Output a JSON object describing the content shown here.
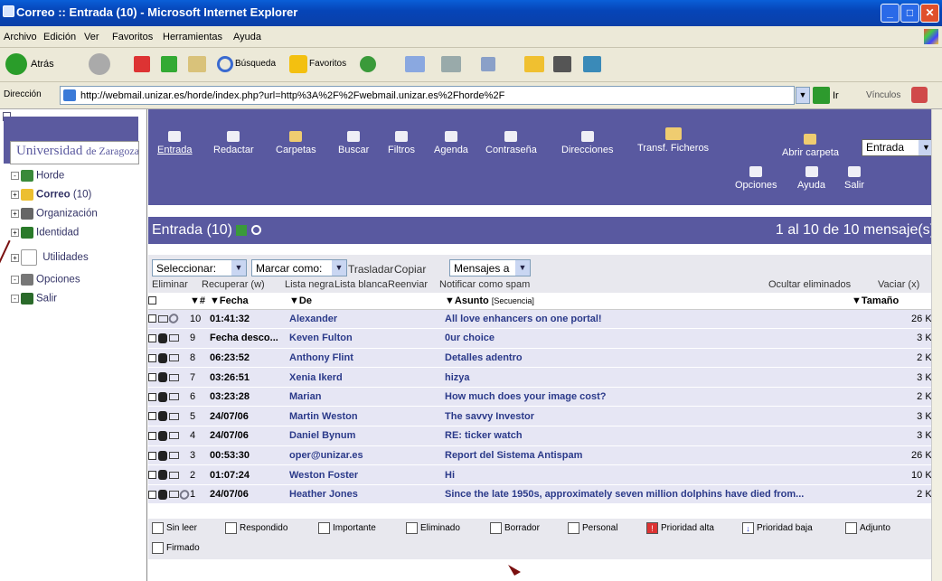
{
  "window": {
    "title": "Correo :: Entrada (10) - Microsoft Internet Explorer",
    "min": "_",
    "max": "□",
    "close": "✕"
  },
  "menu": [
    "Archivo",
    "Edición",
    "Ver",
    "Favoritos",
    "Herramientas",
    "Ayuda"
  ],
  "toolbar": {
    "back": "Atrás",
    "search": "Búsqueda",
    "favorites": "Favoritos"
  },
  "address": {
    "label": "Dirección",
    "url": "http://webmail.unizar.es/horde/index.php?url=http%3A%2F%2Fwebmail.unizar.es%2Fhorde%2F",
    "go": "Ir",
    "links": "Vínculos"
  },
  "sidebar": {
    "logo_line1": "Universidad",
    "logo_line2": "de Zaragoza",
    "items": [
      {
        "label": "Horde"
      },
      {
        "label": "Correo",
        "count": "(10)"
      },
      {
        "label": "Organización"
      },
      {
        "label": "Identidad"
      },
      {
        "label": "Utilidades"
      },
      {
        "label": "Opciones"
      },
      {
        "label": "Salir"
      }
    ]
  },
  "nav": {
    "items": [
      "Entrada",
      "Redactar",
      "Carpetas",
      "Buscar",
      "Filtros",
      "Agenda",
      "Contraseña",
      "Direcciones",
      "Transf. Ficheros"
    ],
    "open_folder": "Abrir carpeta",
    "folder_select": "Entrada",
    "options": "Opciones",
    "help": "Ayuda",
    "exit": "Salir"
  },
  "header": {
    "folder": "Entrada (10)",
    "range": "1 al 10 de 10 mensaje(s)"
  },
  "actions": {
    "select": "Seleccionar:",
    "mark_as": "Marcar como:",
    "move": "Trasladar",
    "copy": "Copiar",
    "messages_to": "Mensajes a",
    "links": [
      "Eliminar",
      "Recuperar (w)",
      "Lista negra",
      "Lista blanca",
      "Reenviar",
      "Notificar como spam"
    ],
    "hide_deleted": "Ocultar eliminados",
    "empty": "Vaciar (x)"
  },
  "columns": {
    "num": "▼#",
    "date": "▼Fecha",
    "from": "▼De",
    "subject": "▼Asunto",
    "sequence": "[Secuencia]",
    "size": "▼Tamaño"
  },
  "messages": [
    {
      "num": "10",
      "date": "01:41:32",
      "from": "Alexander",
      "subject": "All love enhancers on one portal!",
      "size": "26 KB"
    },
    {
      "num": "9",
      "date": "Fecha desco...",
      "from": "Keven Fulton",
      "subject": "0ur choice",
      "size": "3 KB"
    },
    {
      "num": "8",
      "date": "06:23:52",
      "from": "Anthony Flint",
      "subject": "Detalles adentro",
      "size": "2 KB"
    },
    {
      "num": "7",
      "date": "03:26:51",
      "from": "Xenia Ikerd",
      "subject": "hizya",
      "size": "3 KB"
    },
    {
      "num": "6",
      "date": "03:23:28",
      "from": "Marian",
      "subject": "How much does your image cost?",
      "size": "2 KB"
    },
    {
      "num": "5",
      "date": "24/07/06",
      "from": "Martin Weston",
      "subject": "The savvy Investor",
      "size": "3 KB"
    },
    {
      "num": "4",
      "date": "24/07/06",
      "from": "Daniel Bynum",
      "subject": "RE: ticker watch",
      "size": "3 KB"
    },
    {
      "num": "3",
      "date": "00:53:30",
      "from": "oper@unizar.es",
      "subject": "Report del Sistema Antispam",
      "size": "26 KB"
    },
    {
      "num": "2",
      "date": "01:07:24",
      "from": "Weston Foster",
      "subject": "Hi",
      "size": "10 KB"
    },
    {
      "num": "1",
      "date": "24/07/06",
      "from": "Heather Jones",
      "subject": "Since the late 1950s, approximately seven million dolphins have died from...",
      "size": "2 KB"
    }
  ],
  "legend": [
    "Sin leer",
    "Respondido",
    "Importante",
    "Eliminado",
    "Borrador",
    "Personal",
    "Prioridad alta",
    "Prioridad baja",
    "Adjunto",
    "Firmado"
  ]
}
